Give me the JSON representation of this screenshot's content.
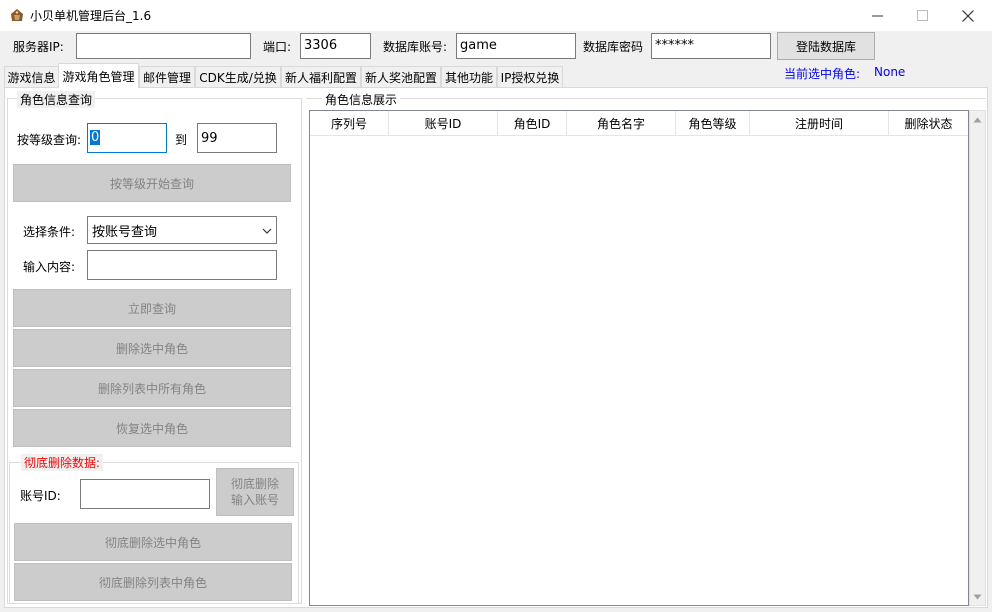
{
  "window": {
    "title": "小贝单机管理后台_1.6"
  },
  "connection": {
    "server_ip_label": "服务器IP:",
    "server_ip_value": "",
    "port_label": "端口:",
    "port_value": "3306",
    "db_account_label": "数据库账号:",
    "db_account_value": "game",
    "db_password_label": "数据库密码",
    "db_password_value": "******",
    "login_button": "登陆数据库"
  },
  "tabs": [
    {
      "label": "游戏信息"
    },
    {
      "label": "游戏角色管理"
    },
    {
      "label": "邮件管理"
    },
    {
      "label": "CDK生成/兑换"
    },
    {
      "label": "新人福利配置"
    },
    {
      "label": "新人奖池配置"
    },
    {
      "label": "其他功能"
    },
    {
      "label": "IP授权兑换"
    }
  ],
  "selected_role": {
    "label": "当前选中角色:",
    "value": "None"
  },
  "query_group": {
    "title": "角色信息查询",
    "level_label": "按等级查询:",
    "level_from": "0",
    "to_label": "到",
    "level_to": "99",
    "level_query_button": "按等级开始查询",
    "condition_label": "选择条件:",
    "condition_selected": "按账号查询",
    "input_label": "输入内容:",
    "input_value": "",
    "query_now_button": "立即查询",
    "delete_selected_button": "删除选中角色",
    "delete_all_button": "删除列表中所有角色",
    "restore_button": "恢复选中角色"
  },
  "purge_group": {
    "title": "彻底删除数据:",
    "account_label": "账号ID:",
    "account_value": "",
    "purge_input_button_line1": "彻底删除",
    "purge_input_button_line2": "输入账号",
    "purge_selected_button": "彻底删除选中角色",
    "purge_all_button": "彻底删除列表中角色"
  },
  "display_group": {
    "title": "角色信息展示",
    "columns": [
      "序列号",
      "账号ID",
      "角色ID",
      "角色名字",
      "角色等级",
      "注册时间",
      "删除状态"
    ]
  },
  "colors": {
    "accent_blue": "#0000ff",
    "purge_title_red": "#ff0000",
    "selection_highlight": "#0078d7"
  }
}
